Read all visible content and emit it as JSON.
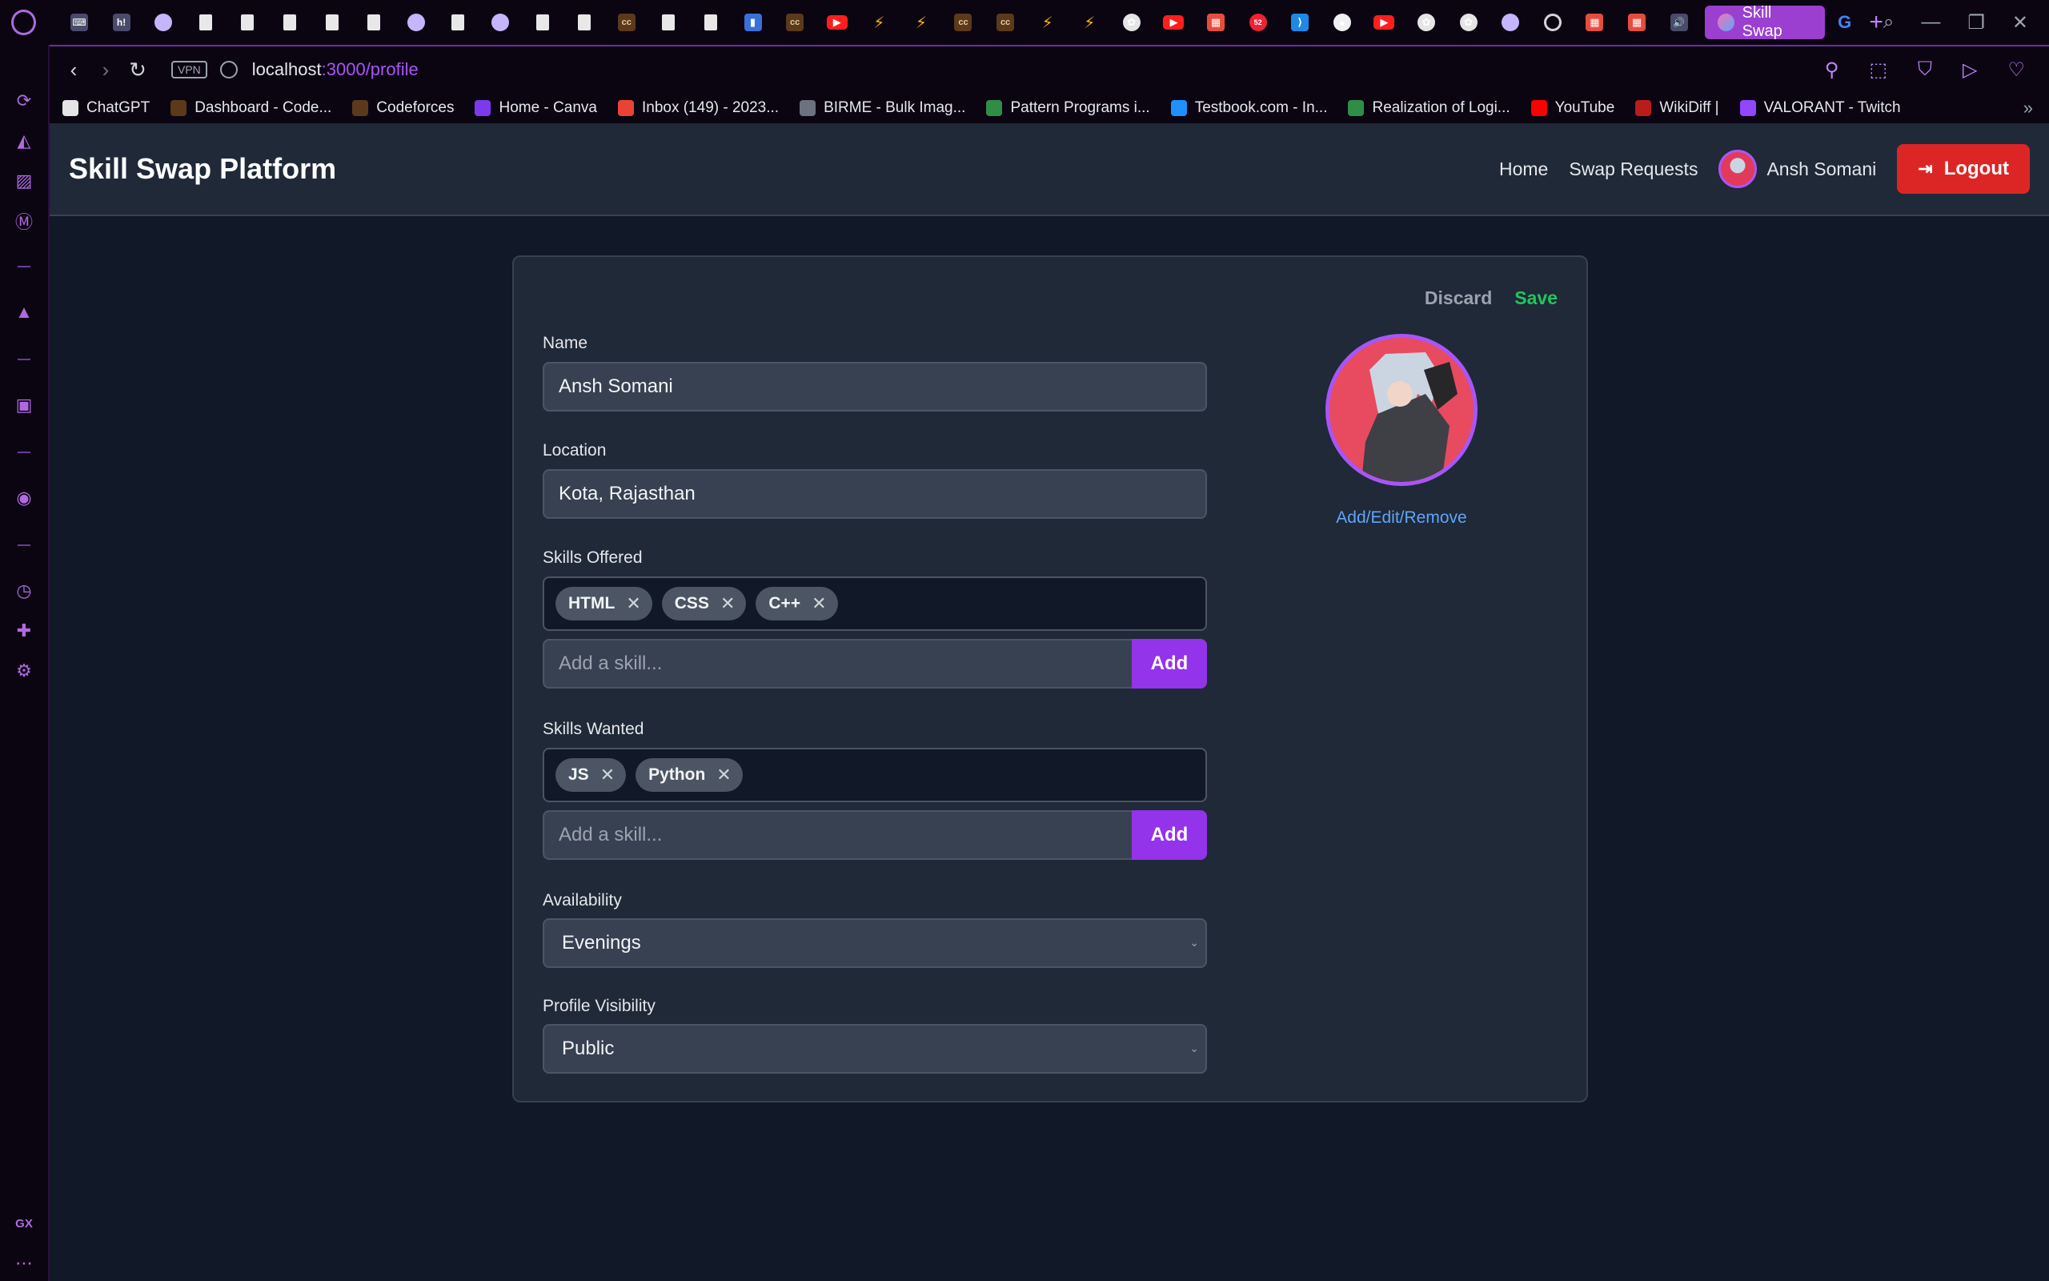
{
  "browser": {
    "active_tab_title": "Skill Swap",
    "pinned_tabs": [
      "gamepad",
      "h",
      "globe",
      "doc",
      "doc",
      "doc",
      "doc",
      "doc",
      "globe",
      "doc",
      "globe",
      "doc",
      "doc",
      "cc",
      "doc",
      "doc",
      "chart",
      "cc",
      "yt",
      "bolt",
      "bolt",
      "cc",
      "cc",
      "bolt",
      "bolt",
      "oa",
      "yt",
      "multi",
      "badge",
      "code",
      "gh",
      "yt",
      "oa",
      "oa",
      "globe",
      "ring",
      "multi",
      "multi",
      "speaker"
    ],
    "vpn_label": "VPN",
    "url_host": "localhost",
    "url_path": ":3000/profile",
    "bookmarks": [
      {
        "label": "ChatGPT",
        "icon": "openai-icon",
        "color": "#e5e5e5"
      },
      {
        "label": "Dashboard - Code...",
        "icon": "codechef-icon",
        "color": "#5a3a1a"
      },
      {
        "label": "Codeforces",
        "icon": "codeforces-icon",
        "color": "#5a3a1a"
      },
      {
        "label": "Home - Canva",
        "icon": "canva-icon",
        "color": "#7c3aed"
      },
      {
        "label": "Inbox (149) - 2023...",
        "icon": "gmail-icon",
        "color": "#ea4335"
      },
      {
        "label": "BIRME - Bulk Imag...",
        "icon": "birme-icon",
        "color": "#6b7280"
      },
      {
        "label": "Pattern Programs i...",
        "icon": "gfg-icon",
        "color": "#2f8d46"
      },
      {
        "label": "Testbook.com - In...",
        "icon": "testbook-icon",
        "color": "#1e90ff"
      },
      {
        "label": "Realization of Logi...",
        "icon": "gfg-icon",
        "color": "#2f8d46"
      },
      {
        "label": "YouTube",
        "icon": "youtube-icon",
        "color": "#ff0000"
      },
      {
        "label": "WikiDiff |",
        "icon": "wikidiff-icon",
        "color": "#b91c1c"
      },
      {
        "label": "VALORANT - Twitch",
        "icon": "twitch-icon",
        "color": "#9146ff"
      }
    ]
  },
  "header": {
    "brand": "Skill Swap Platform",
    "nav_home": "Home",
    "nav_requests": "Swap Requests",
    "user_name": "Ansh Somani",
    "logout_label": "Logout"
  },
  "profile": {
    "discard_label": "Discard",
    "save_label": "Save",
    "name_label": "Name",
    "name_value": "Ansh Somani",
    "location_label": "Location",
    "location_value": "Kota, Rajasthan",
    "skills_offered_label": "Skills Offered",
    "skills_offered": [
      "HTML",
      "CSS",
      "C++"
    ],
    "skills_wanted_label": "Skills Wanted",
    "skills_wanted": [
      "JS",
      "Python"
    ],
    "add_skill_placeholder": "Add a skill...",
    "add_label": "Add",
    "availability_label": "Availability",
    "availability_value": "Evenings",
    "visibility_label": "Profile Visibility",
    "visibility_value": "Public",
    "photo_link": "Add/Edit/Remove"
  },
  "colors": {
    "accent": "#9333ea",
    "logout": "#dc2626",
    "save": "#22c55e",
    "link": "#60a5fa"
  }
}
